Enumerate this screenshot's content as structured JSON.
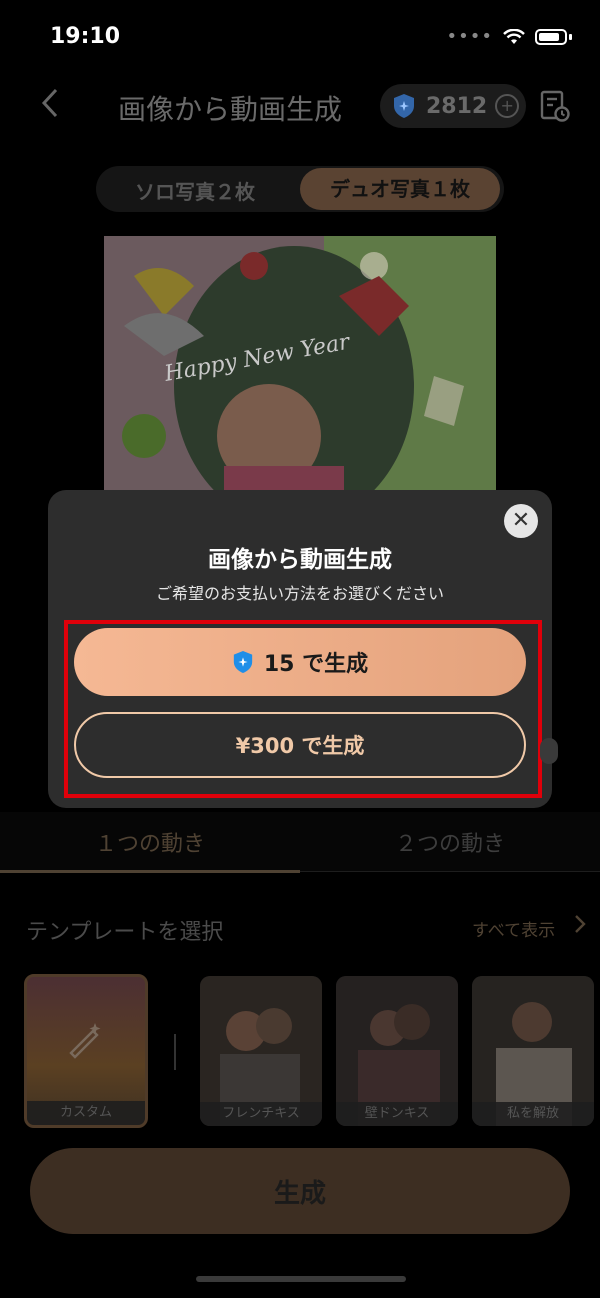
{
  "status_bar": {
    "time": "19:10",
    "signal_dots": "••••"
  },
  "header": {
    "title": "画像から動画生成",
    "credits": "2812"
  },
  "segment": {
    "solo": "ソロ写真２枚",
    "duo": "デュオ写真１枚"
  },
  "preview": {
    "caption": "Happy New Year"
  },
  "tabs": {
    "one": "１つの動き",
    "two": "２つの動き"
  },
  "templates": {
    "title": "テンプレートを選択",
    "show_all": "すべて表示",
    "items": [
      {
        "label": "カスタム"
      },
      {
        "label": "フレンチキス"
      },
      {
        "label": "壁ドンキス"
      },
      {
        "label": "私を解放"
      }
    ]
  },
  "generate_button": "生成",
  "modal": {
    "title": "画像から動画生成",
    "subtitle": "ご希望のお支払い方法をお選びください",
    "credit_option": "15 で生成",
    "yen_option": "¥300 で生成"
  },
  "colors": {
    "accent": "#f0b08c",
    "highlight_box": "#e0000a"
  }
}
